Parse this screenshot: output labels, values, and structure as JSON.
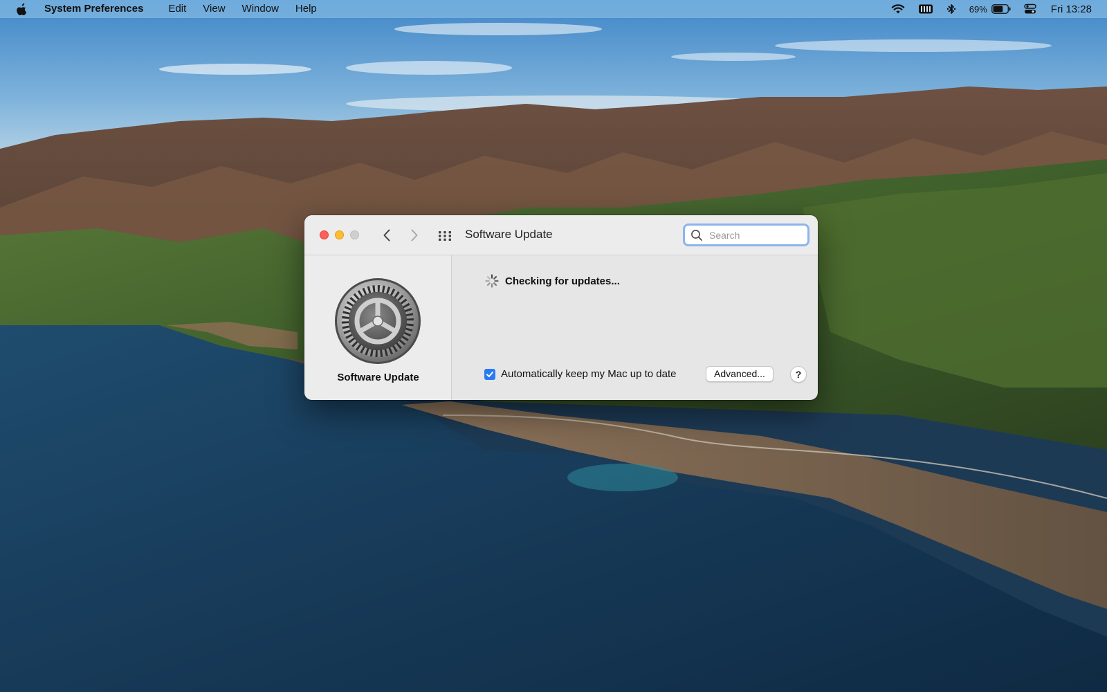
{
  "menubar": {
    "app_name": "System Preferences",
    "items": [
      "Edit",
      "View",
      "Window",
      "Help"
    ],
    "battery_percent": "69%",
    "clock": "Fri 13:28",
    "status_icons": [
      "wifi-icon",
      "keyboard-input-icon",
      "bluetooth-icon",
      "battery-icon",
      "control-center-icon"
    ]
  },
  "window": {
    "title": "Software Update",
    "search": {
      "placeholder": "Search",
      "value": ""
    },
    "sidebar": {
      "icon": "software-update-gear-icon",
      "label": "Software Update"
    },
    "main": {
      "status": "Checking for updates...",
      "auto_update": {
        "label": "Automatically keep my Mac up to date",
        "checked": true
      },
      "advanced_button": "Advanced...",
      "help_button": "?"
    }
  },
  "colors": {
    "accent": "#2a7af3",
    "close": "#fe5f57",
    "minimize": "#febc2e",
    "zoom_inactive": "#cfcfcf"
  }
}
